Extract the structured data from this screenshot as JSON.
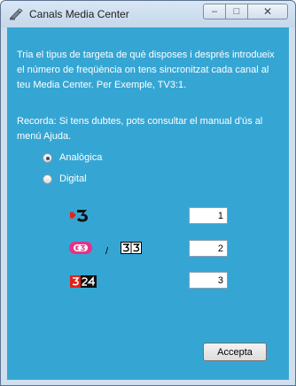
{
  "window": {
    "title": "Canals Media Center"
  },
  "titlebar": {
    "minimize": "–",
    "maximize": "□",
    "close": "✕"
  },
  "instructions": {
    "paragraph1": "Tria el tipus de targeta de què disposes i després introdueix el número de freqüència on tens sincronitzat cada canal al teu Media Center. Per Exemple, TV3:1.",
    "paragraph2": "Recorda: Si tens dubtes, pots consultar el manual d'ús al menú Ajuda."
  },
  "card_type": {
    "options": [
      {
        "label": "Analògica",
        "selected": true
      },
      {
        "label": "Digital",
        "selected": false
      }
    ]
  },
  "channels": [
    {
      "logo": "tv3-logo",
      "value": "1"
    },
    {
      "logo": "k3-33-logo",
      "separator": "/",
      "value": "2"
    },
    {
      "logo": "3-24-logo",
      "value": "3"
    }
  ],
  "footer": {
    "accept_label": "Accepta"
  },
  "colors": {
    "client_bg": "#35a6d4",
    "logo_red": "#e2221a",
    "k3_pink": "#e6308a"
  }
}
